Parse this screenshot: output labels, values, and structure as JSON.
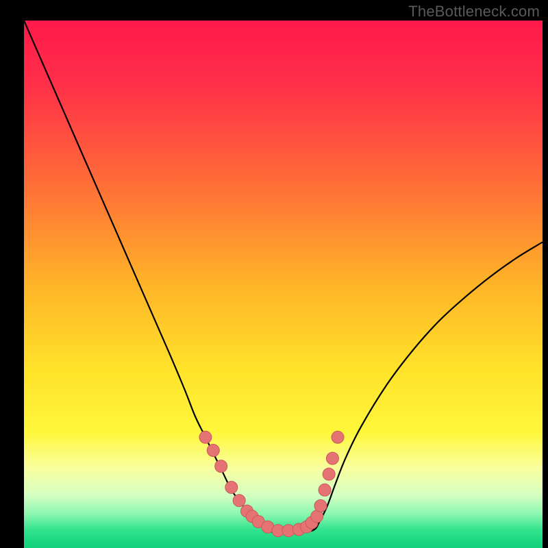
{
  "watermark": "TheBottleneck.com",
  "chart_data": {
    "type": "line",
    "title": "",
    "xlabel": "",
    "ylabel": "",
    "xlim": [
      0,
      100
    ],
    "ylim": [
      0,
      100
    ],
    "series": [
      {
        "name": "curve-left",
        "x": [
          0,
          4,
          8,
          12,
          16,
          20,
          24,
          28,
          31,
          33,
          35,
          37,
          38.5,
          40,
          41.5,
          43,
          44.5,
          46,
          48
        ],
        "y": [
          100,
          91,
          82,
          73,
          64,
          55,
          46,
          37,
          30,
          25,
          21,
          17,
          14,
          11,
          9,
          7,
          5.5,
          4,
          3
        ]
      },
      {
        "name": "curve-bottom",
        "x": [
          48,
          50,
          52,
          54,
          56
        ],
        "y": [
          3,
          3,
          3,
          3,
          3.5
        ]
      },
      {
        "name": "curve-right",
        "x": [
          56,
          57,
          58.5,
          60,
          62,
          65,
          70,
          75,
          80,
          85,
          90,
          95,
          100
        ],
        "y": [
          3.5,
          5,
          8,
          12,
          17,
          23,
          31,
          37.5,
          43,
          47.5,
          51.5,
          55,
          58
        ]
      }
    ],
    "markers": {
      "name": "highlight-dots",
      "x": [
        35,
        36.5,
        38,
        40,
        41.5,
        43,
        44,
        45.2,
        47,
        49,
        51,
        53,
        54.5,
        55.5,
        56.5,
        57.2,
        58,
        58.8,
        59.5,
        60.5
      ],
      "y": [
        21,
        18.5,
        15.5,
        11.5,
        9,
        7,
        6,
        5,
        4,
        3.3,
        3.3,
        3.5,
        4,
        4.8,
        6,
        8,
        11,
        14,
        17,
        21
      ]
    },
    "gradient_stops": [
      {
        "offset": 0.0,
        "color": "#ff1a4b"
      },
      {
        "offset": 0.12,
        "color": "#ff2f49"
      },
      {
        "offset": 0.3,
        "color": "#ff6a38"
      },
      {
        "offset": 0.5,
        "color": "#ffb428"
      },
      {
        "offset": 0.66,
        "color": "#ffe22a"
      },
      {
        "offset": 0.78,
        "color": "#fff73b"
      },
      {
        "offset": 0.85,
        "color": "#f8ffa0"
      },
      {
        "offset": 0.9,
        "color": "#d4ffc2"
      },
      {
        "offset": 0.935,
        "color": "#8cf7b0"
      },
      {
        "offset": 0.965,
        "color": "#34e38e"
      },
      {
        "offset": 1.0,
        "color": "#0fd07a"
      }
    ],
    "line_color": "#000000",
    "marker_color": "#e57373",
    "marker_stroke": "#c85a5a",
    "marker_radius_px": 9
  }
}
